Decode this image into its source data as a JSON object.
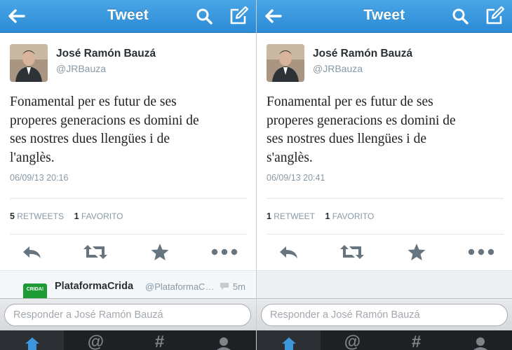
{
  "colors": {
    "header": "#2c8bd6",
    "accent_icon": "#66757f",
    "muted": "#8899a6"
  },
  "panels": [
    {
      "header_title": "Tweet",
      "author_name": "José Ramón Bauzá",
      "author_handle": "@JRBauza",
      "tweet_lines": [
        "Fonamental per es futur de ses",
        "properes generacions es domini de",
        "ses nostres dues llengües i de",
        "l'anglès."
      ],
      "timestamp": "06/09/13 20:16",
      "retweets_count": "5",
      "retweets_label": "RETWEETS",
      "favorites_count": "1",
      "favorites_label": "FAVORITO",
      "reply_preview": {
        "name": "PlataformaCrida",
        "handle": "@PlataformaC…",
        "time": "5m",
        "avatar_text": "CRIDA!"
      },
      "reply_placeholder": "Responder a José Ramón Bauzá",
      "tabs": [
        "home-icon",
        "mentions-icon",
        "discover-icon",
        "profile-icon"
      ],
      "tab_glyphs": [
        "⌂",
        "@",
        "#",
        "👤"
      ]
    },
    {
      "header_title": "Tweet",
      "author_name": "José Ramón Bauzá",
      "author_handle": "@JRBauza",
      "tweet_lines": [
        "Fonamental per es futur de ses",
        "properes generacions es domini de",
        "ses nostres dues llengües i de",
        "s'anglès."
      ],
      "timestamp": "06/09/13 20:41",
      "retweets_count": "1",
      "retweets_label": "RETWEET",
      "favorites_count": "1",
      "favorites_label": "FAVORITO",
      "reply_placeholder": "Responder a José Ramón Bauzá",
      "tabs": [
        "home-icon",
        "mentions-icon",
        "discover-icon",
        "profile-icon"
      ],
      "tab_glyphs": [
        "⌂",
        "@",
        "#",
        "👤"
      ]
    }
  ]
}
